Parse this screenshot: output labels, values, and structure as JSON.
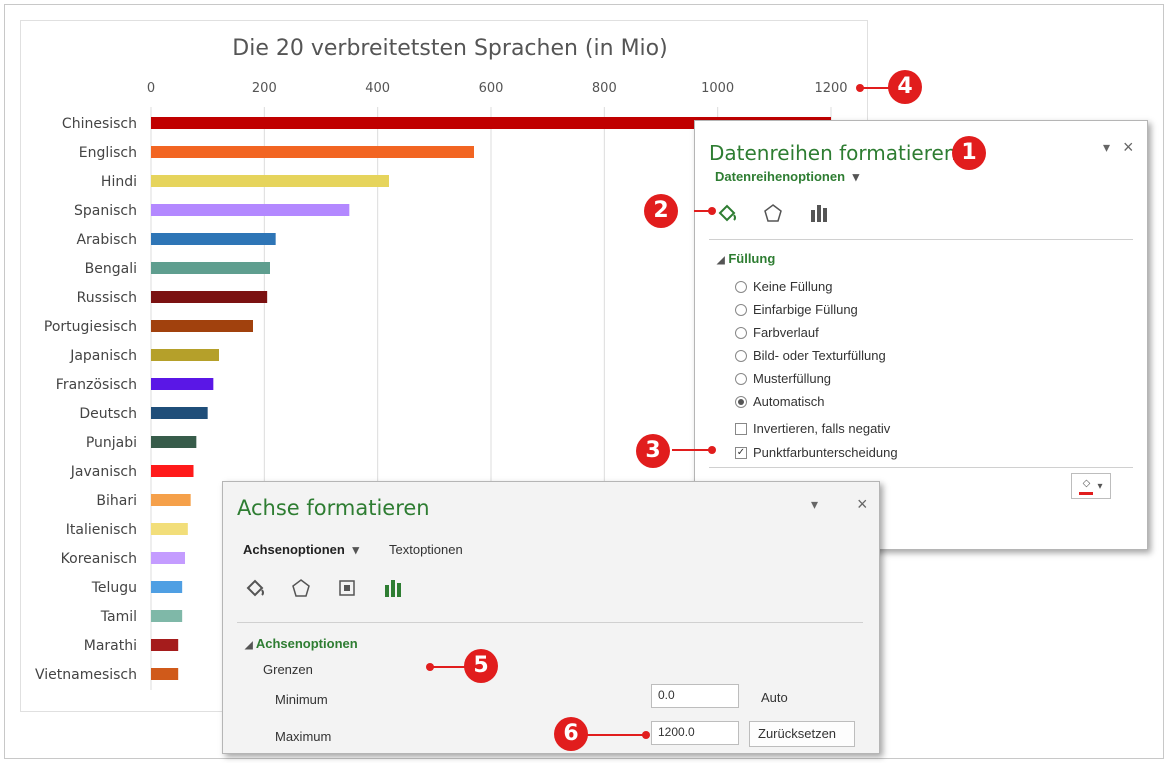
{
  "chart_data": {
    "type": "bar",
    "title": "Die 20 verbreitetsten Sprachen (in Mio)",
    "xlim": [
      0,
      1200
    ],
    "ticks": [
      "0",
      "200",
      "400",
      "600",
      "800",
      "1000",
      "1200"
    ],
    "grid": true,
    "categories": [
      "Chinesisch",
      "Englisch",
      "Hindi",
      "Spanisch",
      "Arabisch",
      "Bengali",
      "Russisch",
      "Portugiesisch",
      "Japanisch",
      "Französisch",
      "Deutsch",
      "Punjabi",
      "Javanisch",
      "Bihari",
      "Italienisch",
      "Koreanisch",
      "Telugu",
      "Tamil",
      "Marathi",
      "Vietnamesisch"
    ],
    "values": [
      1200,
      570,
      420,
      350,
      220,
      210,
      205,
      180,
      120,
      110,
      100,
      80,
      75,
      70,
      65,
      60,
      55,
      55,
      48,
      48
    ],
    "colors": [
      "#c00000",
      "#f26522",
      "#e6d45c",
      "#b388ff",
      "#2e75b6",
      "#5f9e8f",
      "#7b1111",
      "#a1410d",
      "#b5a02a",
      "#5a17e6",
      "#1f4e79",
      "#375c4a",
      "#ff1a1a",
      "#f5a04a",
      "#f2de7a",
      "#c49cff",
      "#4f9fe3",
      "#7fb8a8",
      "#a51c1c",
      "#d05a1a"
    ]
  },
  "panel1": {
    "title": "Datenreihen formatieren",
    "subtitle": "Datenreihenoptionen",
    "section": "Füllung",
    "options": [
      "Keine Füllung",
      "Einfarbige Füllung",
      "Farbverlauf",
      "Bild- oder Texturfüllung",
      "Musterfüllung",
      "Automatisch"
    ],
    "selected_option": "Automatisch",
    "checkboxes": [
      {
        "label": "Invertieren, falls negativ",
        "checked": false
      },
      {
        "label": "Punktfarbunterscheidung",
        "checked": true
      }
    ],
    "close": "×",
    "dropdown": "▾"
  },
  "panel2": {
    "title": "Achse formatieren",
    "tab_active": "Achsenoptionen",
    "tab_other": "Textoptionen",
    "section": "Achsenoptionen",
    "group": "Grenzen",
    "minimum_label": "Minimum",
    "minimum_value": "0.0",
    "minimum_state": "Auto",
    "maximum_label": "Maximum",
    "maximum_value": "1200.0",
    "reset_label": "Zurücksetzen",
    "close": "×",
    "dropdown": "▾"
  },
  "markers": [
    "1",
    "2",
    "3",
    "4",
    "5",
    "6"
  ],
  "colors": {
    "accent_green": "#2e7d32",
    "marker_red": "#e11d1d"
  }
}
